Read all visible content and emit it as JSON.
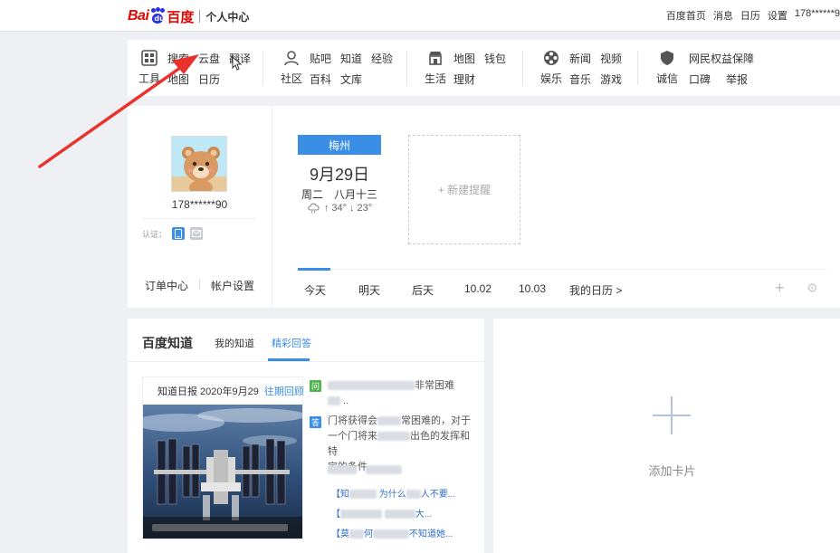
{
  "topbar": {
    "logo_bai": "Bai",
    "logo_du": "du",
    "logo_zh": "百度",
    "logo_sub": "个人中心",
    "links": [
      "百度首页",
      "消息",
      "日历",
      "设置",
      "178******9"
    ]
  },
  "tools": {
    "groups": [
      {
        "label": "工具",
        "icon": "grid-icon",
        "links": [
          "搜索",
          "云盘",
          "翻译",
          "地图",
          "日历"
        ]
      },
      {
        "label": "社区",
        "icon": "user-icon",
        "links": [
          "贴吧",
          "知道",
          "经验",
          "百科",
          "文库"
        ]
      },
      {
        "label": "生活",
        "icon": "shop-icon",
        "links": [
          "地图",
          "钱包",
          "理财"
        ]
      },
      {
        "label": "娱乐",
        "icon": "film-reel-icon",
        "links": [
          "新闻",
          "视频",
          "音乐",
          "游戏"
        ]
      },
      {
        "label": "诚信",
        "icon": "shield-icon",
        "links": [
          "网民权益保障",
          "口碑",
          "举报"
        ]
      }
    ]
  },
  "profile": {
    "username": "178******90",
    "verify_label": "认证：",
    "links": [
      "订单中心",
      "帐户设置"
    ]
  },
  "calendar": {
    "city": "梅州",
    "date": "9月29日",
    "lunar": "周二　八月十三",
    "weather": "34° ↓ 23°",
    "weather_high": "34°",
    "weather_low": "23°",
    "new_reminder": "+ 新建提醒",
    "tabs": [
      "今天",
      "明天",
      "后天",
      "10.02",
      "10.03",
      "我的日历 >"
    ]
  },
  "zhidao": {
    "title": "百度知道",
    "tabs": [
      "我的知道",
      "精彩回答"
    ],
    "daily_title": "知道日报 2020年9月29",
    "daily_link": "往期回顾",
    "q_tag": "问",
    "a_tag": "答",
    "q_text": "非常困难",
    "a_text_1": "门将获得会",
    "a_text_2": "常困难的，对于",
    "a_text_3": "一个门将来",
    "a_text_4": "出色的发挥和特",
    "a_text_5": "定的条件",
    "related": [
      "【知",
      "为什么",
      "人不要...",
      "【",
      "大...",
      "【莫",
      "何",
      "不知道她..."
    ]
  },
  "addcard": {
    "label": "添加卡片"
  },
  "colors": {
    "accent": "#3a8ee6",
    "brand_red": "#e10601",
    "brand_blue": "#2932e1",
    "annotation_red": "#e8322b"
  }
}
